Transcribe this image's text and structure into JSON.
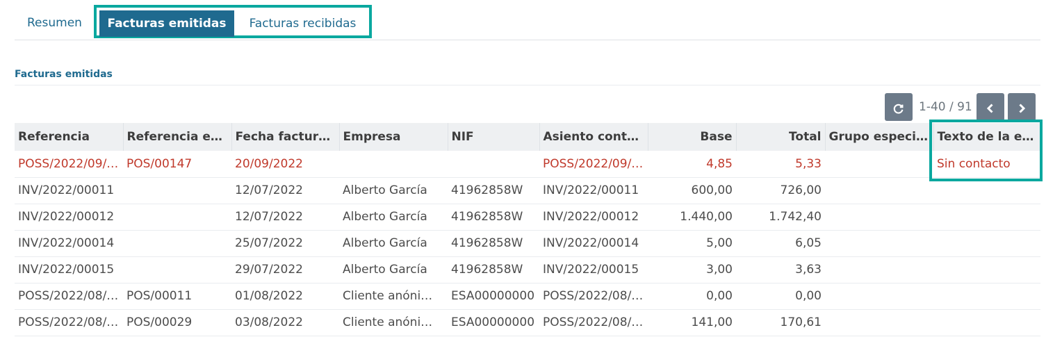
{
  "tabs": {
    "resumen": "Resumen",
    "emitidas": "Facturas emitidas",
    "recibidas": "Facturas recibidas"
  },
  "section": {
    "title": "Facturas emitidas"
  },
  "pager": {
    "range": "1-40 / 91",
    "refresh_icon": "refresh-icon",
    "prev_icon": "chevron-left-icon",
    "next_icon": "chevron-right-icon"
  },
  "colors": {
    "accent": "#1f6a8f",
    "highlight": "#0aa89f",
    "danger": "#c0392b"
  },
  "table": {
    "columns": [
      "Referencia",
      "Referencia ext…",
      "Fecha factura…",
      "Empresa",
      "NIF",
      "Asiento conta…",
      "Base",
      "Total",
      "Grupo especi…",
      "Texto de la ex…"
    ],
    "rows": [
      [
        "POSS/2022/09/…",
        "POS/00147",
        "20/09/2022",
        "",
        "",
        "POSS/2022/09/…",
        "4,85",
        "5,33",
        "",
        "Sin contacto"
      ],
      [
        "INV/2022/00011",
        "",
        "12/07/2022",
        "Alberto García",
        "41962858W",
        "INV/2022/00011",
        "600,00",
        "726,00",
        "",
        ""
      ],
      [
        "INV/2022/00012",
        "",
        "12/07/2022",
        "Alberto García",
        "41962858W",
        "INV/2022/00012",
        "1.440,00",
        "1.742,40",
        "",
        ""
      ],
      [
        "INV/2022/00014",
        "",
        "25/07/2022",
        "Alberto García",
        "41962858W",
        "INV/2022/00014",
        "5,00",
        "6,05",
        "",
        ""
      ],
      [
        "INV/2022/00015",
        "",
        "29/07/2022",
        "Alberto García",
        "41962858W",
        "INV/2022/00015",
        "3,00",
        "3,63",
        "",
        ""
      ],
      [
        "POSS/2022/08/…",
        "POS/00011",
        "01/08/2022",
        "Cliente anóni…",
        "ESA00000000",
        "POSS/2022/08/…",
        "0,00",
        "0,00",
        "",
        ""
      ],
      [
        "POSS/2022/08/…",
        "POS/00029",
        "03/08/2022",
        "Cliente anóni…",
        "ESA00000000",
        "POSS/2022/08/…",
        "141,00",
        "170,61",
        "",
        ""
      ]
    ]
  }
}
